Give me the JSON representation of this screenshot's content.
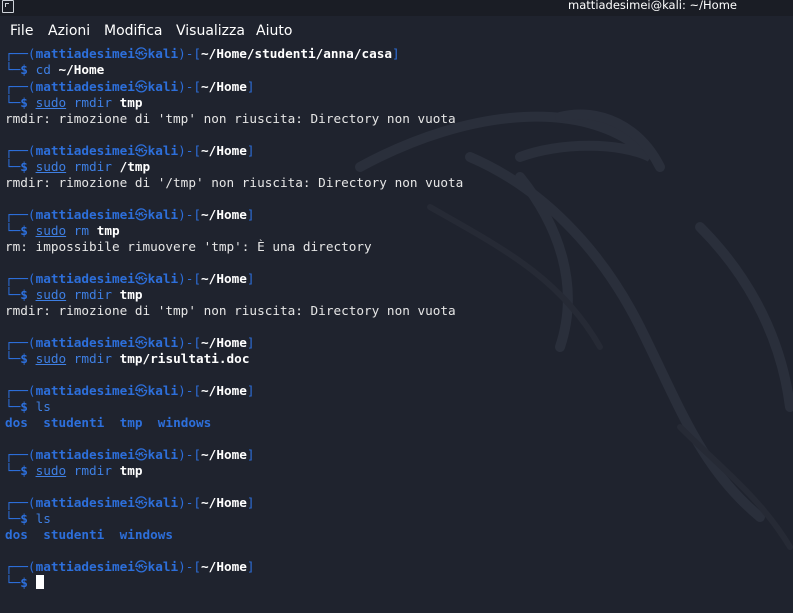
{
  "window": {
    "title": "mattiadesimei@kali: ~/Home"
  },
  "menu": [
    "File",
    "Azioni",
    "Modifica",
    "Visualizza",
    "Aiuto"
  ],
  "prompt": {
    "user": "mattiadesimei",
    "host": "kali",
    "at_icon": "at-circle-icon"
  },
  "blocks": [
    {
      "path": "~/Home/studenti/anna/casa",
      "cmd": "cd",
      "sudo": false,
      "args": "~/Home",
      "output": ""
    },
    {
      "path": "~/Home",
      "cmd": "rmdir",
      "sudo": true,
      "args": "tmp",
      "output": "rmdir: rimozione di 'tmp' non riuscita: Directory non vuota"
    },
    {
      "path": "~/Home",
      "cmd": "rmdir",
      "sudo": true,
      "args": "/tmp",
      "output": "rmdir: rimozione di '/tmp' non riuscita: Directory non vuota"
    },
    {
      "path": "~/Home",
      "cmd": "rm",
      "sudo": true,
      "args": "tmp",
      "output": "rm: impossibile rimuovere 'tmp': È una directory"
    },
    {
      "path": "~/Home",
      "cmd": "rmdir",
      "sudo": true,
      "args": "tmp",
      "output": "rmdir: rimozione di 'tmp' non riuscita: Directory non vuota"
    },
    {
      "path": "~/Home",
      "cmd": "rmdir",
      "sudo": true,
      "args": "tmp/risultati.doc",
      "output": ""
    },
    {
      "path": "~/Home",
      "cmd": "ls",
      "sudo": false,
      "args": "",
      "ls_output": [
        "dos",
        "studenti",
        "tmp",
        "windows"
      ]
    },
    {
      "path": "~/Home",
      "cmd": "rmdir",
      "sudo": true,
      "args": "tmp",
      "output": ""
    },
    {
      "path": "~/Home",
      "cmd": "ls",
      "sudo": false,
      "args": "",
      "ls_output": [
        "dos",
        "studenti",
        "windows"
      ]
    },
    {
      "path": "~/Home",
      "cmd": "",
      "sudo": false,
      "args": "",
      "output": "",
      "cursor": true
    }
  ],
  "colors": {
    "background": "#1f232e",
    "prompt_blue": "#2d6fdb",
    "command_blue": "#3e7fe3",
    "text": "#e6e6e6"
  }
}
